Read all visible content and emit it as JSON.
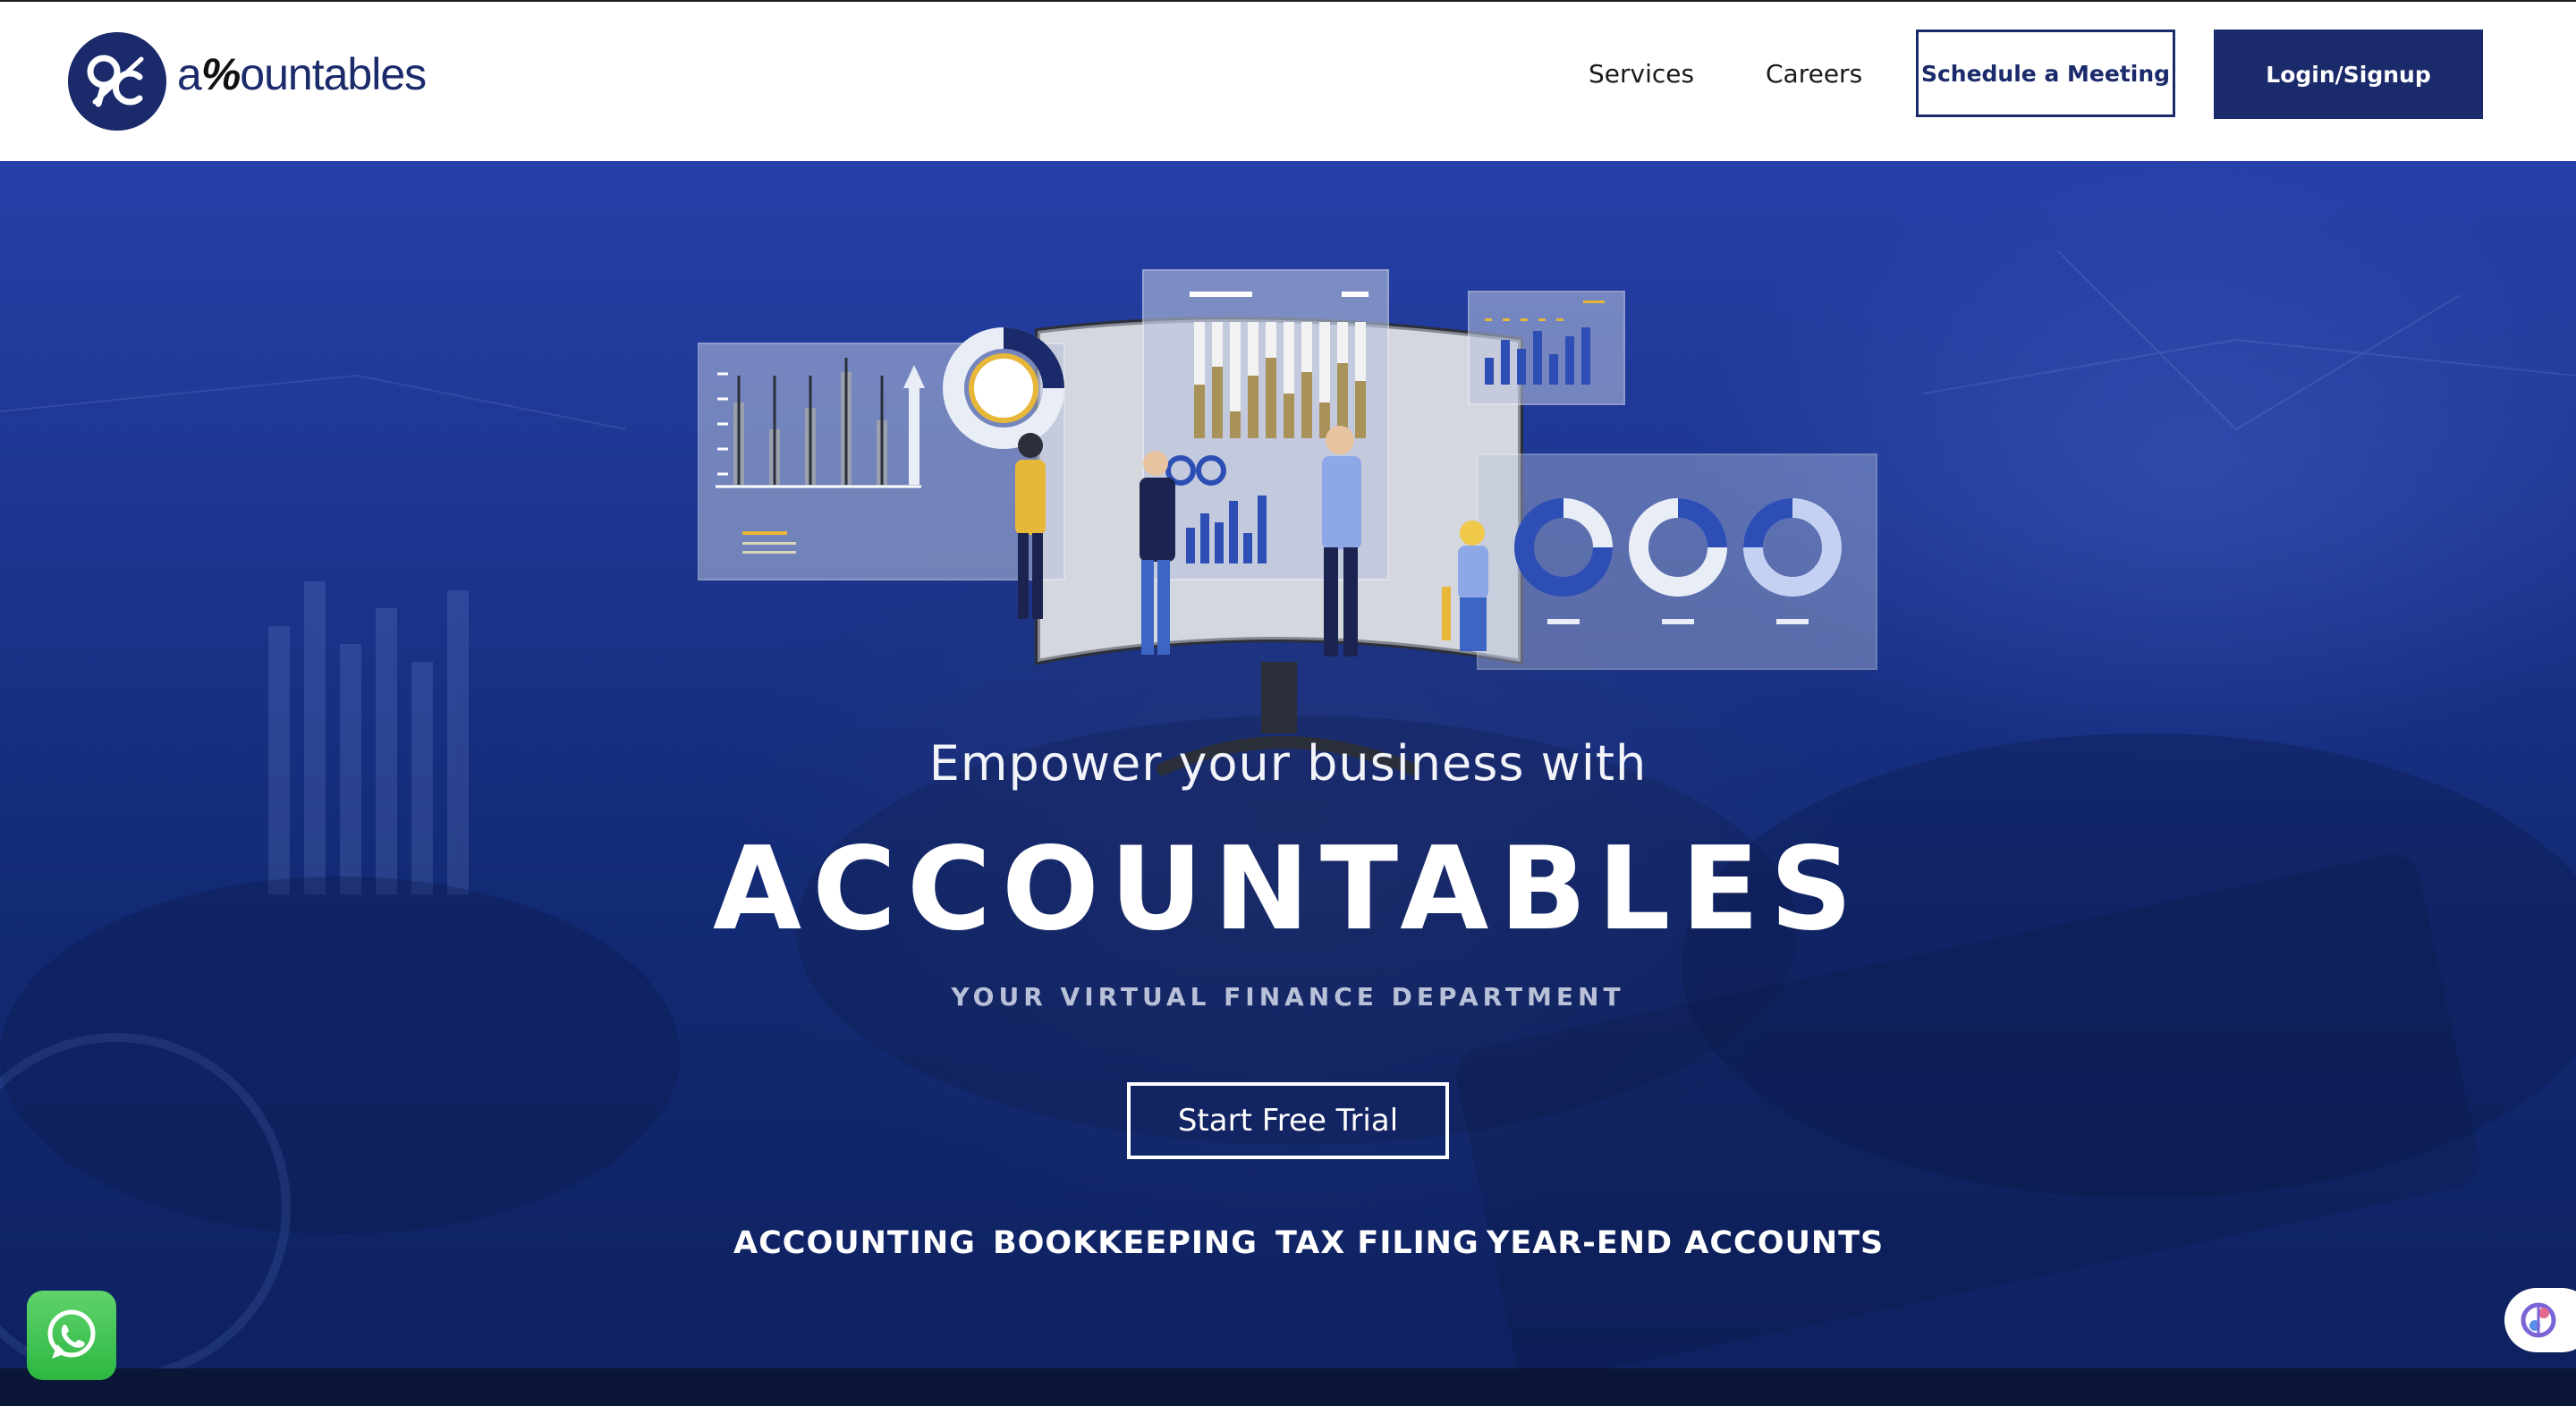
{
  "header": {
    "logo_text_a": "a",
    "logo_text_mid": "%",
    "logo_text_rest": "ountables",
    "logo_mark": "%",
    "nav": {
      "services": "Services",
      "careers": "Careers"
    },
    "schedule_label": "Schedule a Meeting",
    "login_label": "Login/Signup"
  },
  "hero": {
    "tagline": "Empower your business with",
    "brand": "ACCOUNTABLES",
    "subtitle": "YOUR VIRTUAL FINANCE DEPARTMENT",
    "cta_label": "Start Free Trial",
    "services": [
      "ACCOUNTING",
      "BOOKKEEPING",
      "TAX FILING",
      "YEAR-END ACCOUNTS"
    ]
  },
  "icons": {
    "whatsapp": "whatsapp-icon",
    "assistant": "brain-icon"
  },
  "colors": {
    "brand_navy": "#1b2a6b",
    "hero_blue": "#1d3690",
    "white": "#ffffff",
    "accent_gold": "#e7b73a",
    "whatsapp_green": "#2db742"
  }
}
